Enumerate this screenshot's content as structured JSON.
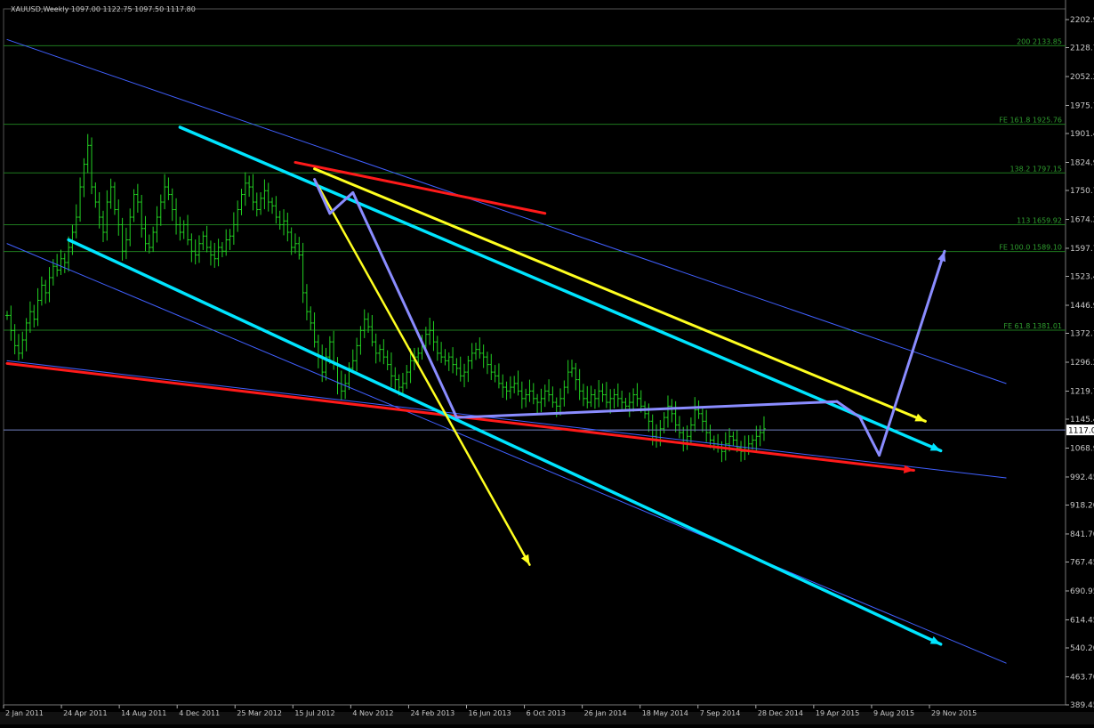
{
  "chart_data": {
    "type": "ohlc",
    "header": "XAUUSD,Weekly 1097.00 1122.75 1097.50 1117.80",
    "y_ticks": [
      "2202.9",
      "2128.70",
      "2052.2",
      "1975.7",
      "1901.4",
      "1824.9",
      "1750.7",
      "1674.2",
      "1597.7",
      "1523.4",
      "1446.9",
      "1372.7",
      "1296.2",
      "1219.7",
      "1145.4",
      "1068.9",
      "992.45",
      "918.20",
      "841.70",
      "767.45",
      "690.95",
      "614.45",
      "540.20",
      "463.70",
      "389.45"
    ],
    "ylim": [
      389.45,
      2202.9
    ],
    "x_ticks": [
      "2 Jan 2011",
      "24 Apr 2011",
      "14 Aug 2011",
      "4 Dec 2011",
      "25 Mar 2012",
      "15 Jul 2012",
      "4 Nov 2012",
      "24 Feb 2013",
      "16 Jun 2013",
      "6 Oct 2013",
      "26 Jan 2014",
      "18 May 2014",
      "7 Sep 2014",
      "28 Dec 2014",
      "19 Apr 2015",
      "9 Aug 2015",
      "29 Nov 2015"
    ],
    "x_ticks_start": "2011-01-02",
    "x_ticks_step_days": 112,
    "current_price": "1117.0",
    "fib_levels": [
      {
        "label": "200 2133.85",
        "value": 2133.85
      },
      {
        "label": "FE 161.8 1925.76",
        "value": 1925.76
      },
      {
        "label": "138.2 1797.15",
        "value": 1797.15
      },
      {
        "label": "113 1659.92",
        "value": 1659.92
      },
      {
        "label": "FE 100.0 1589.10",
        "value": 1589.1
      },
      {
        "label": "FE 61.8 1381.01",
        "value": 1381.01
      }
    ],
    "weekly_closes": [
      1420,
      1380,
      1340,
      1320,
      1355,
      1400,
      1430,
      1410,
      1460,
      1500,
      1480,
      1520,
      1550,
      1540,
      1570,
      1560,
      1600,
      1640,
      1680,
      1760,
      1820,
      1870,
      1760,
      1720,
      1680,
      1640,
      1720,
      1760,
      1700,
      1660,
      1590,
      1620,
      1680,
      1740,
      1720,
      1650,
      1610,
      1600,
      1640,
      1680,
      1720,
      1760,
      1740,
      1700,
      1660,
      1640,
      1660,
      1620,
      1590,
      1580,
      1610,
      1630,
      1600,
      1580,
      1570,
      1600,
      1590,
      1620,
      1630,
      1660,
      1700,
      1740,
      1770,
      1760,
      1720,
      1700,
      1730,
      1750,
      1720,
      1710,
      1680,
      1660,
      1670,
      1640,
      1600,
      1610,
      1580,
      1480,
      1430,
      1400,
      1350,
      1310,
      1270,
      1310,
      1350,
      1290,
      1240,
      1220,
      1240,
      1280,
      1300,
      1340,
      1380,
      1410,
      1390,
      1350,
      1320,
      1330,
      1310,
      1290,
      1260,
      1250,
      1230,
      1240,
      1270,
      1300,
      1310,
      1320,
      1340,
      1370,
      1380,
      1350,
      1320,
      1310,
      1300,
      1310,
      1290,
      1280,
      1260,
      1270,
      1300,
      1320,
      1330,
      1320,
      1310,
      1290,
      1270,
      1260,
      1240,
      1230,
      1220,
      1230,
      1240,
      1220,
      1200,
      1210,
      1220,
      1200,
      1190,
      1200,
      1220,
      1210,
      1190,
      1180,
      1200,
      1230,
      1270,
      1280,
      1250,
      1220,
      1200,
      1190,
      1210,
      1200,
      1220,
      1210,
      1190,
      1200,
      1210,
      1200,
      1190,
      1180,
      1190,
      1210,
      1200,
      1180,
      1160,
      1140,
      1100,
      1090,
      1120,
      1150,
      1180,
      1160,
      1130,
      1110,
      1090,
      1100,
      1130,
      1170,
      1160,
      1140,
      1110,
      1090,
      1080,
      1070,
      1060,
      1080,
      1100,
      1090,
      1070,
      1060,
      1070,
      1080,
      1090,
      1100,
      1110,
      1120
    ]
  },
  "analysis": {
    "main_channel_upper": [
      [
        0,
        2150
      ],
      [
        260,
        1240
      ]
    ],
    "main_channel_lower": [
      [
        0,
        1610
      ],
      [
        260,
        500
      ]
    ],
    "inner_channel_upper": [
      [
        0,
        1300
      ],
      [
        260,
        990
      ]
    ],
    "cyan_upper": [
      [
        45,
        1918
      ],
      [
        243,
        1062
      ]
    ],
    "cyan_lower": [
      [
        16,
        1620
      ],
      [
        243,
        550
      ]
    ],
    "red_lower": [
      [
        0,
        1293
      ],
      [
        236,
        1010
      ]
    ],
    "red_upper": [
      [
        75,
        1825
      ],
      [
        140,
        1690
      ]
    ],
    "yellow_upper": [
      [
        80,
        1808
      ],
      [
        239,
        1140
      ]
    ],
    "yellow_fall": [
      [
        80,
        1780
      ],
      [
        136,
        760
      ]
    ],
    "purple_path": [
      [
        80,
        1780
      ],
      [
        84,
        1690
      ],
      [
        90,
        1745
      ],
      [
        117,
        1150
      ],
      [
        216,
        1192
      ],
      [
        222,
        1150
      ],
      [
        227,
        1050
      ],
      [
        244,
        1590
      ]
    ]
  },
  "colors": {
    "background": "#000000",
    "bars": "#22d022",
    "fib": "#1e7a1e",
    "fib_text": "#2f9e2f",
    "channel": "#4060ff",
    "cyan": "#00e5ff",
    "red": "#ff1a1a",
    "yellow": "#ffff20",
    "purple": "#8a8cff",
    "axis_text": "#c8c8c8"
  }
}
